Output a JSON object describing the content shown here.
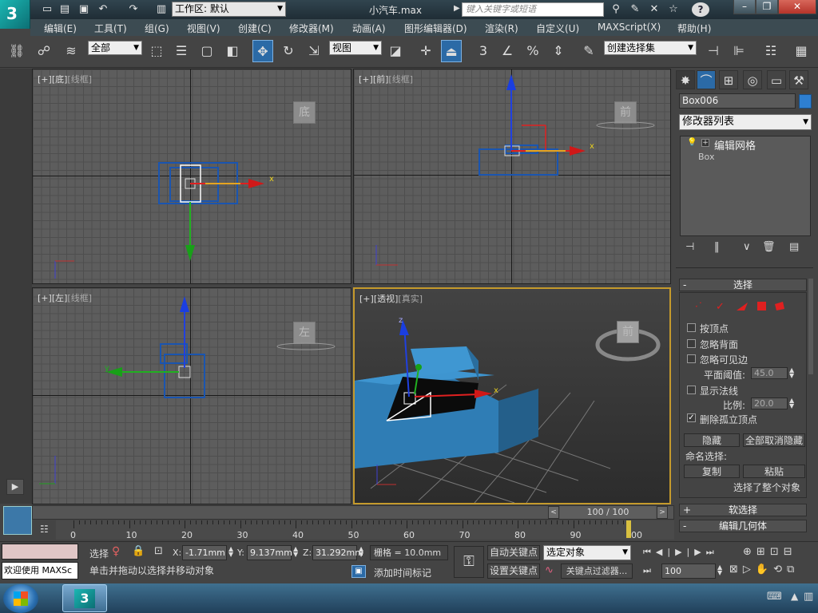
{
  "app": {
    "window_title": "小汽车.max",
    "logo_text": "3",
    "workspace": "工作区: 默认",
    "search_placeholder": "键入关键字或短语",
    "help_label": "?"
  },
  "menus": [
    "编辑(E)",
    "工具(T)",
    "组(G)",
    "视图(V)",
    "创建(C)",
    "修改器(M)",
    "动画(A)",
    "图形编辑器(D)",
    "渲染(R)",
    "自定义(U)",
    "MAXScript(X)",
    "帮助(H)"
  ],
  "toolbar": {
    "filter": "全部",
    "ref_coord": "视图",
    "named_selection": "创建选择集",
    "snap_label": "3",
    "angle_snap": "%"
  },
  "viewports": {
    "top": {
      "label_a": "[+]",
      "label_b": "[底]",
      "label_c": "[线框]",
      "cube": "底"
    },
    "front": {
      "label_a": "[+]",
      "label_b": "[前]",
      "label_c": "[线框]",
      "cube": "前"
    },
    "left": {
      "label_a": "[+]",
      "label_b": "[左]",
      "label_c": "[线框]",
      "cube": "左"
    },
    "persp": {
      "label_a": "[+]",
      "label_b": "[透视]",
      "label_c": "[真实]",
      "cube": "前"
    },
    "axis_x": "x",
    "axis_y": "y",
    "axis_z": "z"
  },
  "command_panel": {
    "object_name": "Box006",
    "object_color": "#2e7fd1",
    "modifier_list": "修改器列表",
    "stack": [
      "编辑网格",
      "Box"
    ],
    "rollout_select": "选择",
    "by_vertex": "按顶点",
    "ignore_backface": "忽略背面",
    "ignore_visible": "忽略可见边",
    "plane_threshold_label": "平面阈值:",
    "plane_threshold": "45.0",
    "show_normals": "显示法线",
    "scale_label": "比例:",
    "scale": "20.0",
    "delete_isolated": "删除孤立顶点",
    "hide": "隐藏",
    "unhide_all": "全部取消隐藏",
    "named_selection": "命名选择:",
    "copy": "复制",
    "paste": "粘贴",
    "selected_whole": "选择了整个对象",
    "soft_selection": "软选择",
    "edit_geometry": "编辑几何体"
  },
  "timeline": {
    "frame": "100 / 100",
    "ticks": [
      "0",
      "10",
      "20",
      "30",
      "40",
      "50",
      "60",
      "70",
      "80",
      "90",
      "100"
    ],
    "current_frame_fraction": 1.0
  },
  "status": {
    "maxscript": "欢迎使用 MAXSc",
    "select_label": "选择",
    "x_label": "X:",
    "x_value": "-1.71mm",
    "y_label": "Y:",
    "y_value": "9.137mm",
    "z_label": "Z:",
    "z_value": "31.292mm",
    "grid": "栅格 = 10.0mm",
    "prompt": "单击并拖动以选择并移动对象",
    "add_time_tag": "添加时间标记",
    "auto_key": "自动关键点",
    "set_key": "设置关键点",
    "selected_object": "选定对象",
    "key_filters": "关键点过滤器...",
    "frame_value": "100"
  },
  "colors": {
    "accent_blue": "#2e7fd1",
    "viewport_border_active": "#c59a2c",
    "car_blue": "#2f7db5"
  }
}
